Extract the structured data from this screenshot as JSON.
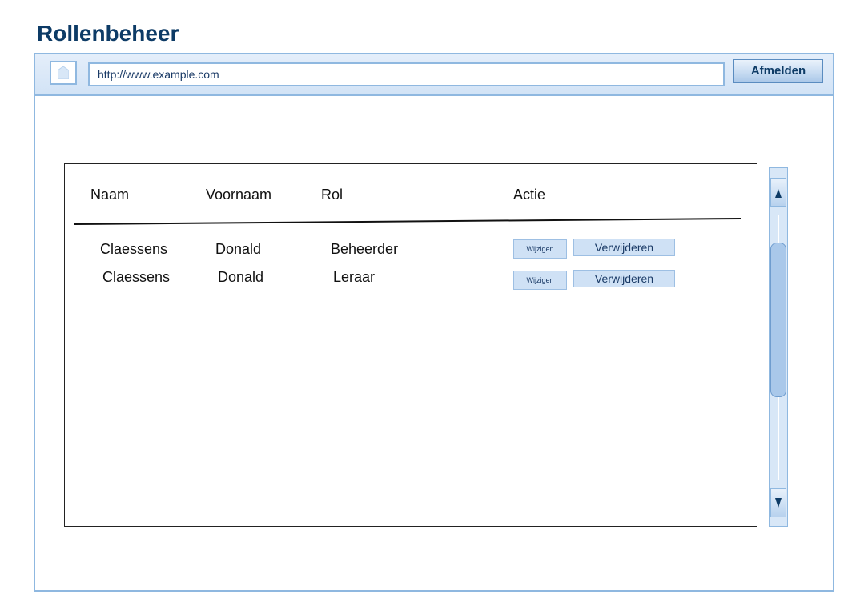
{
  "page": {
    "title": "Rollenbeheer"
  },
  "toolbar": {
    "home_icon": "home-icon",
    "url": "http://www.example.com",
    "logout_label": "Afmelden"
  },
  "table": {
    "columns": [
      "Naam",
      "Voornaam",
      "Rol",
      "Actie"
    ],
    "rows": [
      {
        "naam": "Claessens",
        "voornaam": "Donald",
        "rol": "Beheerder",
        "edit_label": "Wijzigen",
        "delete_label": "Verwijderen"
      },
      {
        "naam": "Claessens",
        "voornaam": "Donald",
        "rol": "Leraar",
        "edit_label": "Wijzigen",
        "delete_label": "Verwijderen"
      }
    ]
  },
  "scrollbar": {
    "up_icon": "arrow-up-icon",
    "down_icon": "arrow-down-icon"
  },
  "colors": {
    "accent": "#8fb8e0",
    "title": "#0d3b66",
    "button_fill": "#cfe1f5"
  }
}
